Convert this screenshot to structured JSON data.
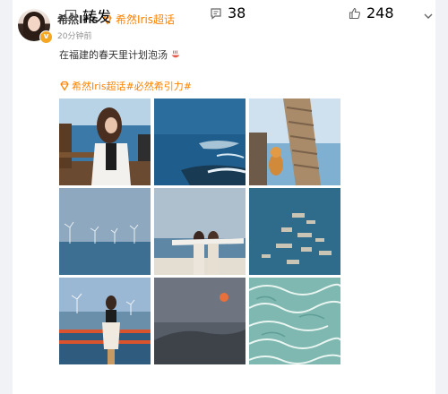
{
  "post": {
    "username": "希然Iris",
    "super_topic_tag": "希然Iris超话",
    "time": "20分钟前",
    "text": "在福建的春天里计划泡汤",
    "topics": "希然Iris超话#必然希引力#"
  },
  "actions": {
    "repost_label": "转发",
    "comment_count": "38",
    "like_count": "248"
  },
  "icons": {
    "verified": "verified-badge-icon",
    "gem": "gem-icon",
    "bowl": "hot-spring-emoji-icon",
    "more": "chevron-down-icon",
    "repost": "repost-icon",
    "comment": "comment-icon",
    "like": "thumbs-up-icon"
  },
  "colors": {
    "accent": "#ff8200",
    "text": "#333333",
    "muted": "#939393"
  },
  "photos": [
    "girl-on-bench-by-sea",
    "ocean-rocks",
    "palm-trunk-cat",
    "wind-turbines-sea",
    "two-girls-arms-open",
    "fish-farm-aerial",
    "girl-red-railing-turbines",
    "sunset-hill-haze",
    "water-caustics"
  ]
}
